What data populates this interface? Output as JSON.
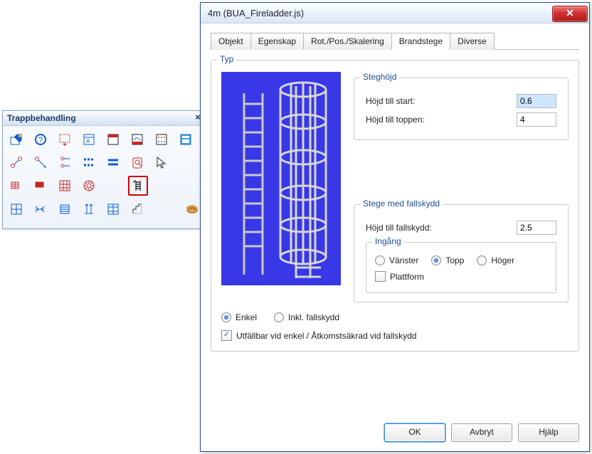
{
  "toolbox": {
    "title": "Trappbehandling",
    "close_glyph": "×"
  },
  "dialog": {
    "title": "4m (BUA_Fireladder.js)",
    "close_glyph": "✕",
    "tabs": {
      "objekt": "Objekt",
      "egenskap": "Egenskap",
      "rotpos": "Rot./Pos./Skalering",
      "brandstege": "Brandstege",
      "diverse": "Diverse"
    },
    "typ_legend": "Typ",
    "steghojd": {
      "legend": "Steghöjd",
      "start_label": "Höjd till start:",
      "start_value": "0.6",
      "topp_label": "Höjd till toppen:",
      "topp_value": "4"
    },
    "fallskydd": {
      "legend": "Stege med fallskydd",
      "hojd_label": "Höjd till fallskydd:",
      "hojd_value": "2.5",
      "ingang_legend": "Ingång",
      "ingang_vanster": "Vänster",
      "ingang_topp": "Topp",
      "ingang_hoger": "Höger",
      "plattform": "Plattform"
    },
    "type_radio": {
      "enkel": "Enkel",
      "inkl": "Inkl. fallskydd"
    },
    "utfallbar": "Utfällbar vid enkel / Åtkomstsäkrad vid fallskydd",
    "buttons": {
      "ok": "OK",
      "cancel": "Avbryt",
      "help": "Hjälp"
    }
  }
}
